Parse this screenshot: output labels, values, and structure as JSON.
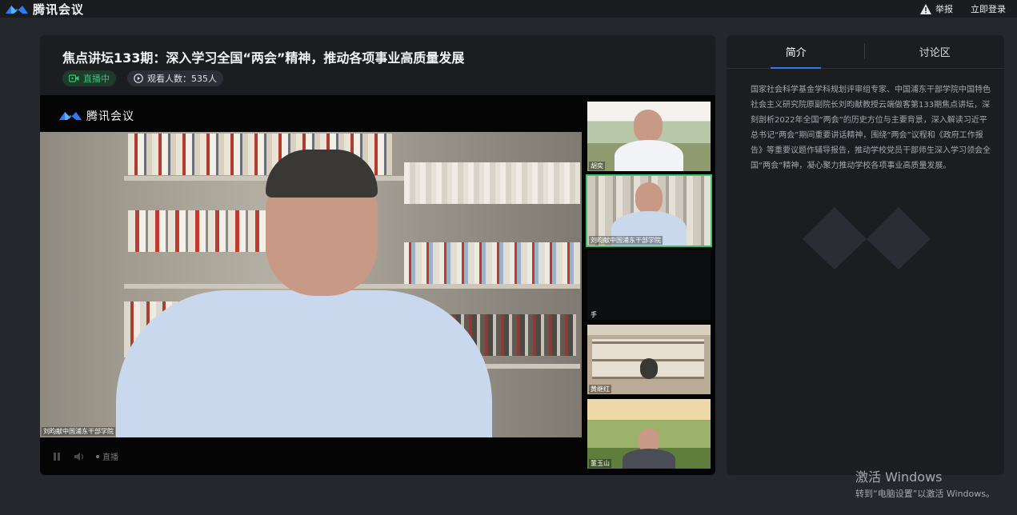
{
  "app": {
    "name": "腾讯会议"
  },
  "topbar": {
    "report_label": "举报",
    "login_label": "立即登录"
  },
  "event": {
    "title": "焦点讲坛133期：深入学习全国“两会”精神，推动各项事业高质量发展",
    "live_label": "直播中",
    "viewers_label": "观看人数：535人"
  },
  "player": {
    "logo_text": "腾讯会议",
    "main_caption": "刘昀献中国浦东干部学院",
    "live_state": "直播"
  },
  "thumbnails": [
    {
      "label": "胡奕"
    },
    {
      "label": "刘昀献中国浦东干部学院"
    },
    {
      "label": "手"
    },
    {
      "label": "黄继红"
    },
    {
      "label": "董玉山"
    }
  ],
  "side": {
    "tabs": [
      {
        "label": "简介"
      },
      {
        "label": "讨论区"
      }
    ],
    "intro": "国家社会科学基金学科规划评审组专家、中国浦东干部学院中国特色社会主义研究院原副院长刘昀献教授云端做客第133期焦点讲坛，深刻剖析2022年全国“两会”的历史方位与主要背景，深入解读习近平总书记“两会”期间重要讲话精神，围绕“两会”议程和《政府工作报告》等重要议题作辅导报告，推动学校党员干部师生深入学习领会全国“两会”精神，凝心聚力推动学校各项事业高质量发展。"
  },
  "windows_notice": {
    "title": "激活 Windows",
    "subtitle": "转到“电脑设置”以激活 Windows。"
  },
  "colors": {
    "accent": "#2f7bf5",
    "live": "#37c27a",
    "brand": "#1f6fff"
  }
}
